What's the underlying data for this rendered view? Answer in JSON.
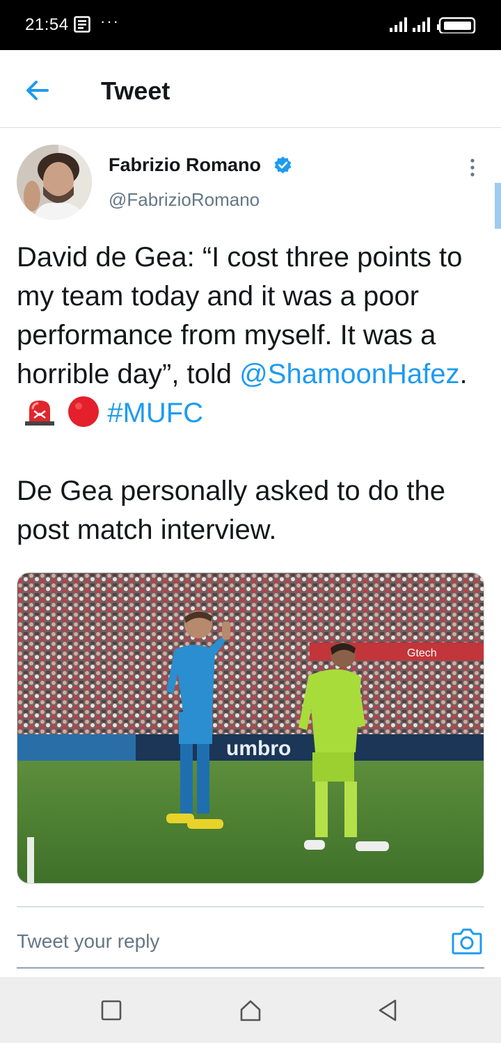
{
  "status_bar": {
    "time": "21:54",
    "overflow": "···",
    "icons": [
      "notification-icon",
      "signal-icon",
      "signal-icon",
      "battery-icon"
    ]
  },
  "header": {
    "title": "Tweet",
    "back_icon": "arrow-left-icon"
  },
  "tweet": {
    "author_name": "Fabrizio Romano",
    "author_handle": "@FabrizioRomano",
    "verified": true,
    "paragraph1": "David de Gea: “I cost three points to my team today and it was a poor performance from myself. It was a horrible day”, told",
    "mention": "@ShamoonHafez",
    "after_mention": ".",
    "emojis": [
      "siren-emoji",
      "red-circle-emoji"
    ],
    "hashtag": "#MUFC",
    "paragraph2": "De Gea personally asked to do the post match interview."
  },
  "media": {
    "type": "photo",
    "banner_text": "umbro",
    "ad_text": "Gtech"
  },
  "reply": {
    "placeholder": "Tweet your reply",
    "camera_icon": "camera-icon"
  },
  "nav": {
    "items": [
      "recents-icon",
      "home-icon",
      "back-icon"
    ]
  },
  "colors": {
    "accent": "#1d9bf0",
    "text": "#14171a",
    "secondary": "#657786",
    "status_bar": "#000000",
    "nav_bar": "#eeeeee"
  }
}
